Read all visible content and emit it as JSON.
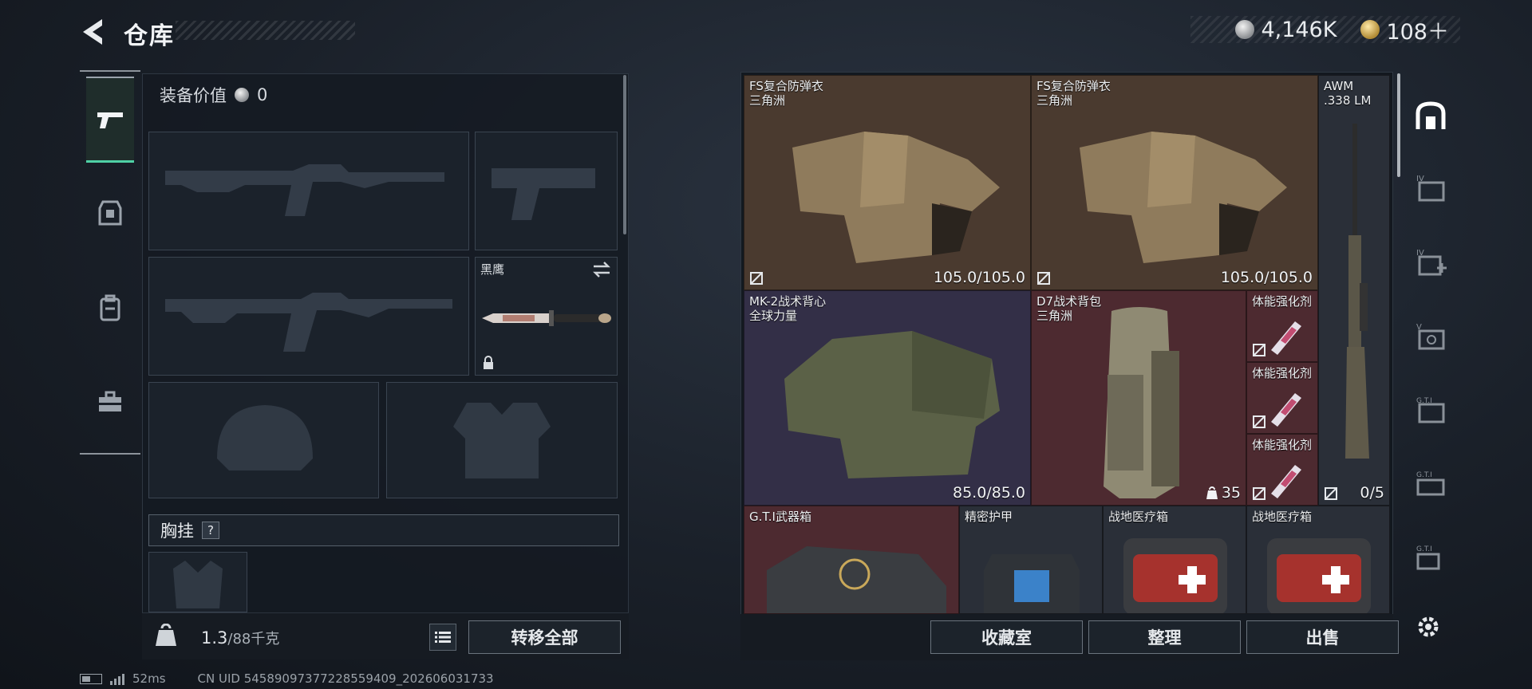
{
  "header": {
    "title": "仓库",
    "currency": [
      {
        "icon": "silver-coin-icon",
        "value": "4,146K"
      },
      {
        "icon": "gold-coin-icon",
        "value": "108＋"
      }
    ]
  },
  "categories": [
    "gun-icon",
    "armor-icon",
    "backpack-icon",
    "toolbox-icon"
  ],
  "equipment": {
    "value_label": "装备价值",
    "value": "0",
    "knife_label": "黑鹰",
    "chest_label": "胸挂",
    "chest_help": "?",
    "weight_current": "1.3",
    "weight_max": "/88千克",
    "transfer_all": "转移全部"
  },
  "storage": {
    "items": [
      {
        "name": "FS复合防弹衣",
        "sub": "三角洲",
        "durability": "105.0/105.0"
      },
      {
        "name": "FS复合防弹衣",
        "sub": "三角洲",
        "durability": "105.0/105.0"
      },
      {
        "name": "AWM",
        "sub": ".338 LM",
        "ammo": "0/5"
      },
      {
        "name": "MK-2战术背心",
        "sub": "全球力量",
        "durability": "85.0/85.0"
      },
      {
        "name": "D7战术背包",
        "sub": "三角洲",
        "count": "35"
      },
      {
        "name": "体能强化剂",
        "sub": ""
      },
      {
        "name": "体能强化剂",
        "sub": ""
      },
      {
        "name": "体能强化剂",
        "sub": ""
      },
      {
        "name": "G.T.I武器箱",
        "sub": ""
      },
      {
        "name": "精密护甲",
        "sub": ""
      },
      {
        "name": "战地医疗箱",
        "sub": ""
      },
      {
        "name": "战地医疗箱",
        "sub": ""
      }
    ],
    "buttons": {
      "collection": "收藏室",
      "organize": "整理",
      "sell": "出售"
    }
  },
  "status": {
    "ping": "52ms",
    "uid": "CN UID 5458909737722855940​9_202606031733"
  }
}
